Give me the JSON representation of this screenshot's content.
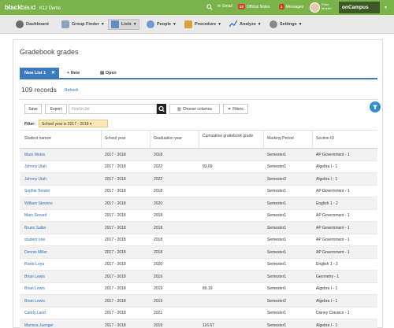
{
  "topbar": {
    "brand_bold": "black",
    "brand_light": "baud",
    "app_name": "K12 Demo",
    "search_icon": "search-icon",
    "email_count": "",
    "email_label": "Email",
    "notes_count": "23",
    "notes_label": "Official Notes",
    "messages_count": "1",
    "messages_label": "Messages",
    "user_first": "Peter",
    "user_last": "Mueller",
    "oncampus_label": "onCampus",
    "accent": "#7ab448"
  },
  "nav": {
    "items": [
      {
        "label": "Dashboard",
        "icon": "dashboard-icon"
      },
      {
        "label": "Group Finder",
        "icon": "group-finder-icon"
      },
      {
        "label": "Lists",
        "icon": "lists-icon"
      },
      {
        "label": "People",
        "icon": "people-icon"
      },
      {
        "label": "Procedure",
        "icon": "procedure-icon"
      },
      {
        "label": "Analyze",
        "icon": "analyze-icon"
      },
      {
        "label": "Settings",
        "icon": "settings-icon"
      }
    ]
  },
  "page": {
    "title": "Gradebook grades",
    "tabs": {
      "active": "New List 1",
      "new_label": "New",
      "open_label": "Open"
    },
    "records": "109 records",
    "refresh": "Refresh"
  },
  "toolbar": {
    "save": "Save",
    "export": "Export",
    "search_placeholder": "Find in list",
    "choose_columns": "Choose columns",
    "filters": "Filters"
  },
  "filter": {
    "label": "Filter:",
    "chip": "School year is 2017 - 2018"
  },
  "table": {
    "headers": [
      "Student name",
      "School year",
      "Graduation year",
      "Cumulative gradebook grade",
      "Marking Period",
      "Section ID"
    ],
    "rows": [
      [
        "Mark Weiss",
        "2017 - 2018",
        "2018",
        "",
        "Semester1",
        "AP Government - 1"
      ],
      [
        "Johnny Utah",
        "2017 - 2018",
        "2022",
        "93.69",
        "Semester1",
        "Algebra I - 1"
      ],
      [
        "Johnny Utah",
        "2017 - 2018",
        "2022",
        "",
        "Semester2",
        "Algebra I - 1"
      ],
      [
        "Sophie Tessier",
        "2017 - 2018",
        "2018",
        "",
        "Semester1",
        "AP Government - 1"
      ],
      [
        "William Stevens",
        "2017 - 2018",
        "2020",
        "",
        "Semester1",
        "English 1 - 2"
      ],
      [
        "Marc Sovard",
        "2017 - 2018",
        "2018",
        "",
        "Semester1",
        "AP Government - 1"
      ],
      [
        "Bruno Salter",
        "2017 - 2018",
        "2018",
        "",
        "Semester1",
        "AP Government - 1"
      ],
      [
        "student one",
        "2017 - 2018",
        "2018",
        "",
        "Semester1",
        "AP Government - 1"
      ],
      [
        "Dennis Miller",
        "2017 - 2018",
        "2018",
        "",
        "Semester1",
        "AP Government - 1"
      ],
      [
        "Rosie Loya",
        "2017 - 2018",
        "2020",
        "",
        "Semester1",
        "English 1 - 2"
      ],
      [
        "Brian Lewis",
        "2017 - 2018",
        "2019",
        "",
        "Semester1",
        "Geometry - 1"
      ],
      [
        "Brian Lewis",
        "2017 - 2018",
        "2019",
        "89.19",
        "Semester1",
        "Algebra I - 1"
      ],
      [
        "Brian Lewis",
        "2017 - 2018",
        "2019",
        "",
        "Semester2",
        "Algebra I - 1"
      ],
      [
        "Candy Land",
        "2017 - 2018",
        "2021",
        "",
        "Semester1",
        "Disney Classics - 1"
      ],
      [
        "Marissa Juenger",
        "2017 - 2018",
        "2019",
        "116.67",
        "Semester1",
        "Algebra I - 1"
      ]
    ]
  }
}
